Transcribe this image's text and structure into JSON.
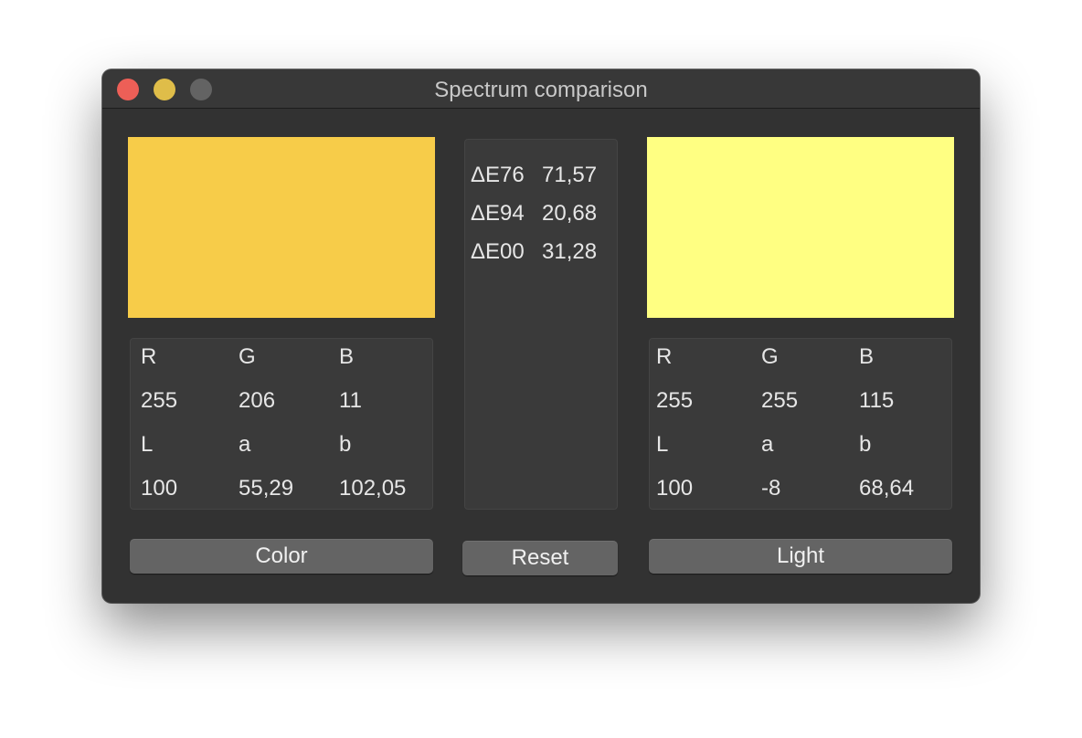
{
  "window": {
    "title": "Spectrum comparison"
  },
  "colors": {
    "left_swatch": "#f7cc49",
    "right_swatch": "#ffff82"
  },
  "left": {
    "headers1": [
      "R",
      "G",
      "B"
    ],
    "values1": [
      "255",
      "206",
      "11"
    ],
    "headers2": [
      "L",
      "a",
      "b"
    ],
    "values2": [
      "100",
      "55,29",
      "102,05"
    ]
  },
  "right": {
    "headers1": [
      "R",
      "G",
      "B"
    ],
    "values1": [
      "255",
      "255",
      "115"
    ],
    "headers2": [
      "L",
      "a",
      "b"
    ],
    "values2": [
      "100",
      "-8",
      "68,64"
    ]
  },
  "delta": [
    {
      "name": "ΔE76",
      "value": "71,57"
    },
    {
      "name": "ΔE94",
      "value": "20,68"
    },
    {
      "name": "ΔE00",
      "value": "31,28"
    }
  ],
  "buttons": {
    "color": "Color",
    "reset": "Reset",
    "light": "Light"
  }
}
